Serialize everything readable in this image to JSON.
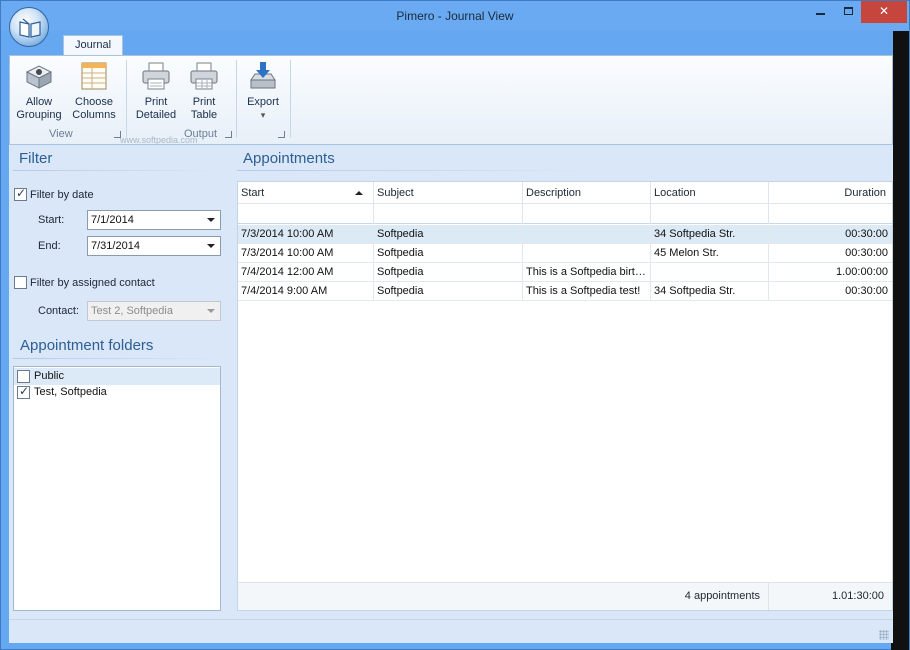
{
  "window": {
    "title": "Pimero - Journal View",
    "minimize_icon": "minimize-icon",
    "maximize_icon": "maximize-icon",
    "close_label": "✕"
  },
  "ribbon": {
    "tabs": [
      {
        "label": "Journal",
        "active": true
      }
    ],
    "groups": [
      {
        "label": "View",
        "buttons": [
          {
            "line1": "Allow",
            "line2": "Grouping",
            "icon": "grouping-icon"
          },
          {
            "line1": "Choose",
            "line2": "Columns",
            "icon": "columns-icon"
          }
        ]
      },
      {
        "label": "Output",
        "buttons": [
          {
            "line1": "Print",
            "line2": "Detailed",
            "icon": "printer-icon"
          },
          {
            "line1": "Print",
            "line2": "Table",
            "icon": "printer-table-icon"
          }
        ]
      },
      {
        "label": "",
        "buttons": [
          {
            "line1": "Export",
            "line2": "▾",
            "icon": "export-icon"
          }
        ]
      }
    ],
    "watermark": "www.softpedia.com"
  },
  "filter": {
    "title": "Filter",
    "by_date": {
      "label": "Filter by date",
      "checked": true
    },
    "start": {
      "label": "Start:",
      "value": "7/1/2014"
    },
    "end": {
      "label": "End:",
      "value": "7/31/2014"
    },
    "by_contact": {
      "label": "Filter by assigned contact",
      "checked": false
    },
    "contact": {
      "label": "Contact:",
      "value": "Test 2, Softpedia",
      "disabled": true
    }
  },
  "folders": {
    "title": "Appointment folders",
    "items": [
      {
        "label": "Public",
        "checked": false
      },
      {
        "label": "Test, Softpedia",
        "checked": true
      }
    ]
  },
  "appointments": {
    "title": "Appointments",
    "columns": [
      "Start",
      "Subject",
      "Description",
      "Location",
      "Duration"
    ],
    "sort_column": "Start",
    "rows": [
      {
        "start": "7/3/2014 10:00 AM",
        "subject": "Softpedia",
        "description": "",
        "location": "34 Softpedia Str.",
        "duration": "00:30:00"
      },
      {
        "start": "7/3/2014 10:00 AM",
        "subject": "Softpedia",
        "description": "",
        "location": "45 Melon Str.",
        "duration": "00:30:00"
      },
      {
        "start": "7/4/2014 12:00 AM",
        "subject": "Softpedia",
        "description": "This is a Softpedia birt…",
        "location": "",
        "duration": "1.00:00:00"
      },
      {
        "start": "7/4/2014 9:00 AM",
        "subject": "Softpedia",
        "description": "This is a Softpedia test!",
        "location": "34 Softpedia Str.",
        "duration": "00:30:00"
      }
    ],
    "selected_row": 0,
    "footer": {
      "count": "4 appointments",
      "total_duration": "1.01:30:00"
    }
  }
}
